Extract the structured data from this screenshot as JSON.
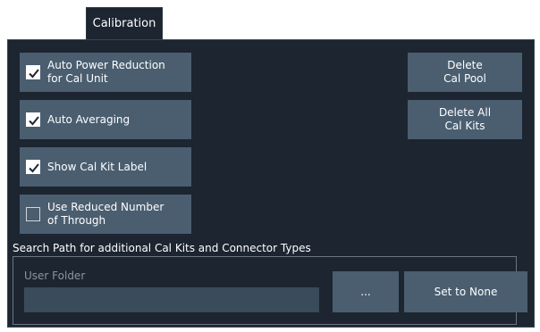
{
  "tab": {
    "label": "Calibration"
  },
  "checkboxes": [
    {
      "label_line1": "Auto Power Reduction",
      "label_line2": "for Cal Unit",
      "checked": true
    },
    {
      "label_line1": "Auto Averaging",
      "label_line2": "",
      "checked": true
    },
    {
      "label_line1": "Show Cal Kit Label",
      "label_line2": "",
      "checked": true
    },
    {
      "label_line1": "Use Reduced Number",
      "label_line2": "of Through",
      "checked": false
    }
  ],
  "buttons": {
    "delete_cal_pool": {
      "line1": "Delete",
      "line2": "Cal Pool"
    },
    "delete_all_cal_kits": {
      "line1": "Delete All",
      "line2": "Cal Kits"
    },
    "browse": "...",
    "set_to_none": "Set to None"
  },
  "search_path": {
    "section_label": "Search Path for additional Cal Kits and Connector Types",
    "field_label": "User Folder",
    "value": ""
  },
  "colors": {
    "background": "#1c2530",
    "button": "#4a5e70",
    "field": "#3a4b5a"
  }
}
